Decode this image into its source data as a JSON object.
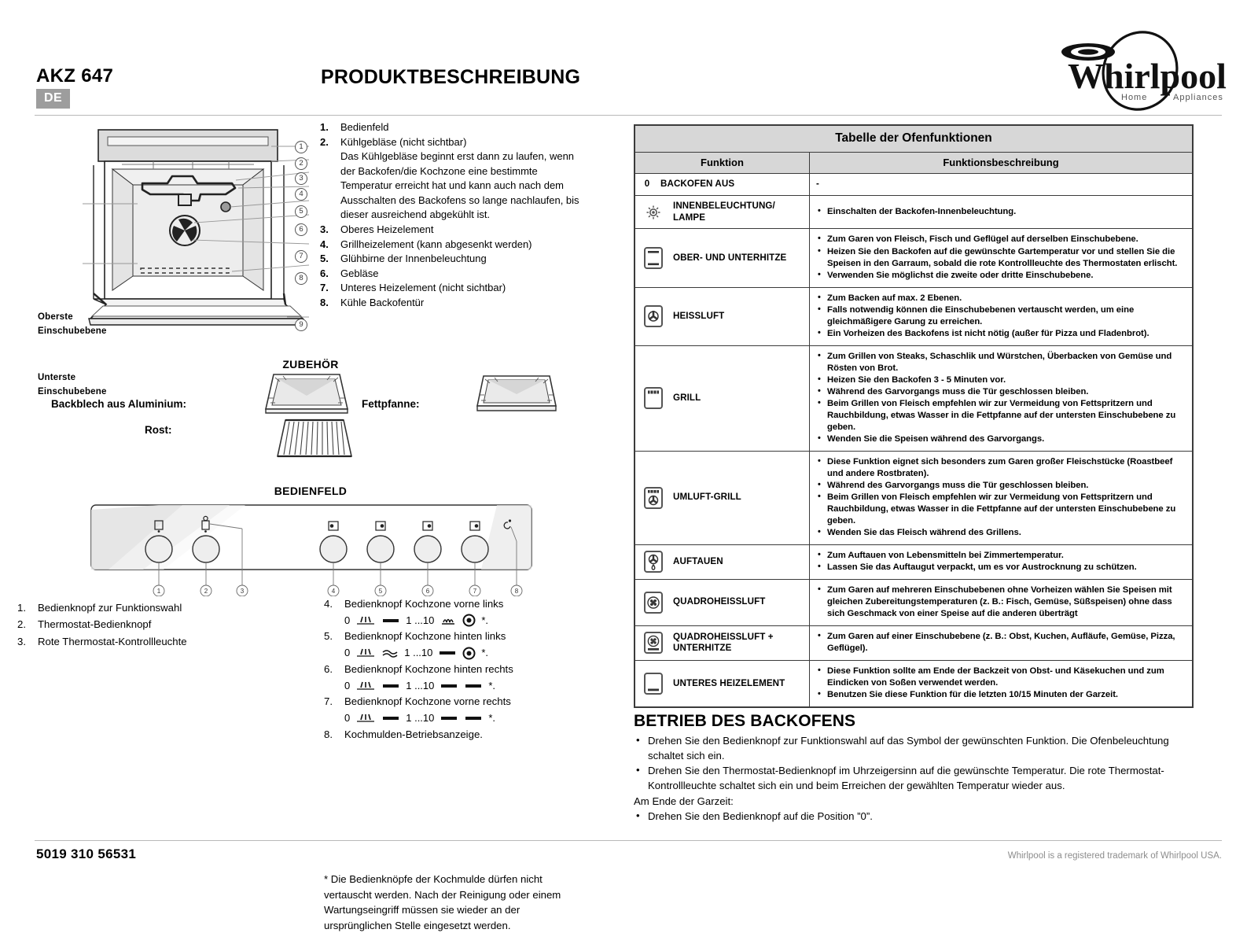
{
  "header": {
    "model": "AKZ 647",
    "language_badge": "DE",
    "title": "PRODUKTBESCHREIBUNG",
    "logo_text": "Whirlpool",
    "logo_tagline": "Home Appliances"
  },
  "oven_diagram": {
    "label_top": "Oberste\nEinschubebene",
    "label_top_line1": "Oberste",
    "label_top_line2": "Einschubebene",
    "label_bottom_line1": "Unterste",
    "label_bottom_line2": "Einschubebene",
    "callouts": [
      "1",
      "2",
      "3",
      "4",
      "5",
      "6",
      "7",
      "8",
      "9"
    ]
  },
  "parts_list": [
    {
      "num": "1.",
      "text": "Bedienfeld",
      "sub": ""
    },
    {
      "num": "2.",
      "text": "Kühlgebläse (nicht sichtbar)",
      "sub": "Das Kühlgebläse beginnt erst dann zu laufen, wenn der Backofen/die Kochzone eine bestimmte Temperatur erreicht hat und kann auch nach dem Ausschalten des Backofens so lange nachlaufen, bis dieser ausreichend abgekühlt ist."
    },
    {
      "num": "3.",
      "text": "Oberes Heizelement",
      "sub": ""
    },
    {
      "num": "4.",
      "text": "Grillheizelement (kann abgesenkt werden)",
      "sub": ""
    },
    {
      "num": "5.",
      "text": "Glühbirne der Innenbeleuchtung",
      "sub": ""
    },
    {
      "num": "6.",
      "text": "Gebläse",
      "sub": ""
    },
    {
      "num": "7.",
      "text": "Unteres Heizelement (nicht sichtbar)",
      "sub": ""
    },
    {
      "num": "8.",
      "text": "Kühle Backofentür",
      "sub": ""
    }
  ],
  "accessories": {
    "title": "ZUBEHÖR",
    "baking_tray_label": "Backblech aus Aluminium:",
    "drip_pan_label": "Fettpfanne:",
    "rack_label": "Rost:"
  },
  "control_panel": {
    "title": "BEDIENFELD",
    "callouts": [
      "1",
      "2",
      "3",
      "4",
      "5",
      "6",
      "7",
      "8"
    ],
    "legend_left": [
      {
        "num": "1.",
        "text": "Bedienknopf zur Funktionswahl"
      },
      {
        "num": "2.",
        "text": "Thermostat-Bedienknopf"
      },
      {
        "num": "3.",
        "text": "Rote Thermostat-Kontrollleuchte"
      }
    ],
    "legend_right": [
      {
        "num": "4.",
        "text": "Bedienknopf Kochzone vorne links",
        "symbols": "0 … — 1 ...10 … ⊙ *."
      },
      {
        "num": "5.",
        "text": "Bedienknopf Kochzone hinten links",
        "symbols": "0 … ≈ 1 ...10 — ⊙ *."
      },
      {
        "num": "6.",
        "text": "Bedienknopf Kochzone hinten rechts",
        "symbols": "0 … — 1 ...10 — — *."
      },
      {
        "num": "7.",
        "text": "Bedienknopf Kochzone vorne rechts",
        "symbols": "0 … — 1 ...10 — — *."
      },
      {
        "num": "8.",
        "text": "Kochmulden-Betriebsanzeige.",
        "symbols": ""
      }
    ],
    "symbol_zero": "0",
    "symbol_range": "1 ...10",
    "symbol_star": "*.",
    "footnote": "* Die Bedienknöpfe der Kochmulde dürfen nicht vertauscht werden. Nach der Reinigung oder einem Wartungseingriff müssen sie wieder an der ursprünglichen Stelle eingesetzt werden."
  },
  "function_table": {
    "title": "Tabelle der Ofenfunktionen",
    "col_function": "Funktion",
    "col_description": "Funktionsbeschreibung",
    "rows": [
      {
        "icon": "zero-off-icon",
        "zero": "0",
        "name": "BACKOFEN AUS",
        "dash": "-",
        "bullets": []
      },
      {
        "icon": "lamp-icon",
        "zero": "",
        "name": "INNENBELEUCHTUNG/ LAMPE",
        "bullets": [
          "Einschalten der Backofen-Innenbeleuchtung."
        ]
      },
      {
        "icon": "top-bottom-heat-icon",
        "zero": "",
        "name": "OBER- UND UNTERHITZE",
        "bullets": [
          "Zum Garen von Fleisch, Fisch und Geflügel auf derselben Einschubebene.",
          "Heizen Sie den Backofen auf die gewünschte Gartemperatur vor und stellen Sie die Speisen in den Garraum, sobald die rote Kontrollleuchte des Thermostaten erlischt.",
          "Verwenden Sie möglichst die zweite oder dritte Einschubebene."
        ]
      },
      {
        "icon": "hot-air-icon",
        "zero": "",
        "name": "HEISSLUFT",
        "bullets": [
          "Zum Backen auf max. 2 Ebenen.",
          "Falls notwendig können die Einschubebenen vertauscht werden, um eine gleichmäßigere Garung zu erreichen.",
          "Ein Vorheizen des Backofens ist nicht nötig (außer für Pizza und Fladenbrot)."
        ]
      },
      {
        "icon": "grill-icon",
        "zero": "",
        "name": "GRILL",
        "bullets": [
          "Zum Grillen von Steaks, Schaschlik und Würstchen, Überbacken von Gemüse und Rösten von Brot.",
          "Heizen Sie den Backofen 3 - 5 Minuten vor.",
          "Während des Garvorgangs muss die Tür geschlossen bleiben.",
          "Beim Grillen von Fleisch empfehlen wir zur Vermeidung von Fettspritzern und Rauchbildung, etwas Wasser in die Fettpfanne auf der untersten Einschubebene zu geben.",
          "Wenden Sie die Speisen während des Garvorgangs."
        ]
      },
      {
        "icon": "fan-grill-icon",
        "zero": "",
        "name": "UMLUFT-GRILL",
        "bullets": [
          "Diese Funktion eignet sich besonders zum Garen großer Fleischstücke (Roastbeef und andere Rostbraten).",
          "Während des Garvorgangs muss die Tür geschlossen bleiben.",
          "Beim Grillen von Fleisch empfehlen wir zur Vermeidung von Fettspritzern und Rauchbildung, etwas Wasser in die Fettpfanne auf der untersten Einschubebene zu geben.",
          "Wenden Sie das Fleisch während des Grillens."
        ]
      },
      {
        "icon": "defrost-icon",
        "zero": "",
        "name": "AUFTAUEN",
        "bullets": [
          "Zum Auftauen von Lebensmitteln bei Zimmertemperatur.",
          "Lassen Sie das Auftaugut verpackt, um es vor Austrocknung zu schützen."
        ]
      },
      {
        "icon": "quadro-hot-air-icon",
        "zero": "",
        "name": "QUADROHEISSLUFT",
        "bullets": [
          "Zum Garen auf mehreren Einschubebenen ohne Vorheizen wählen Sie Speisen mit gleichen Zubereitungstemperaturen (z. B.: Fisch, Gemüse, Süßspeisen) ohne dass sich Geschmack von einer Speise auf die anderen überträgt"
        ]
      },
      {
        "icon": "quadro-hot-air-bottom-icon",
        "zero": "",
        "name": "QUADROHEISSLUFT + UNTERHITZE",
        "bullets": [
          "Zum Garen auf einer Einschubebene (z. B.: Obst, Kuchen, Aufläufe, Gemüse, Pizza, Geflügel)."
        ]
      },
      {
        "icon": "bottom-heat-icon",
        "zero": "",
        "name": "UNTERES HEIZELEMENT",
        "bullets": [
          "Diese Funktion sollte am Ende der Backzeit von Obst- und Käsekuchen und zum Eindicken von Soßen verwendet werden.",
          "Benutzen Sie diese Funktion für die letzten 10/15 Minuten der Garzeit."
        ]
      }
    ]
  },
  "operation": {
    "title": "BETRIEB DES BACKOFENS",
    "lines": [
      {
        "bullet": true,
        "text": "Drehen Sie den Bedienknopf zur Funktionswahl auf das Symbol der gewünschten Funktion. Die Ofenbeleuchtung schaltet sich ein."
      },
      {
        "bullet": true,
        "text": "Drehen Sie den Thermostat-Bedienknopf im Uhrzeigersinn auf die gewünschte Temperatur. Die rote Thermostat-Kontrollleuchte schaltet sich ein und beim Erreichen der gewählten Temperatur wieder aus."
      },
      {
        "bullet": false,
        "text": "Am Ende der Garzeit:"
      },
      {
        "bullet": true,
        "text": "Drehen Sie den Bedienknopf auf die Position ”0”."
      }
    ]
  },
  "footer": {
    "doc_number": "5019 310 56531",
    "trademark": "Whirlpool is a registered trademark of Whirlpool USA."
  },
  "colors": {
    "badge_gray": "#9d9d9d",
    "table_header_gray": "#d7d7d7",
    "rule_gray": "#b9b9b9",
    "border": "#3b3b3b"
  }
}
